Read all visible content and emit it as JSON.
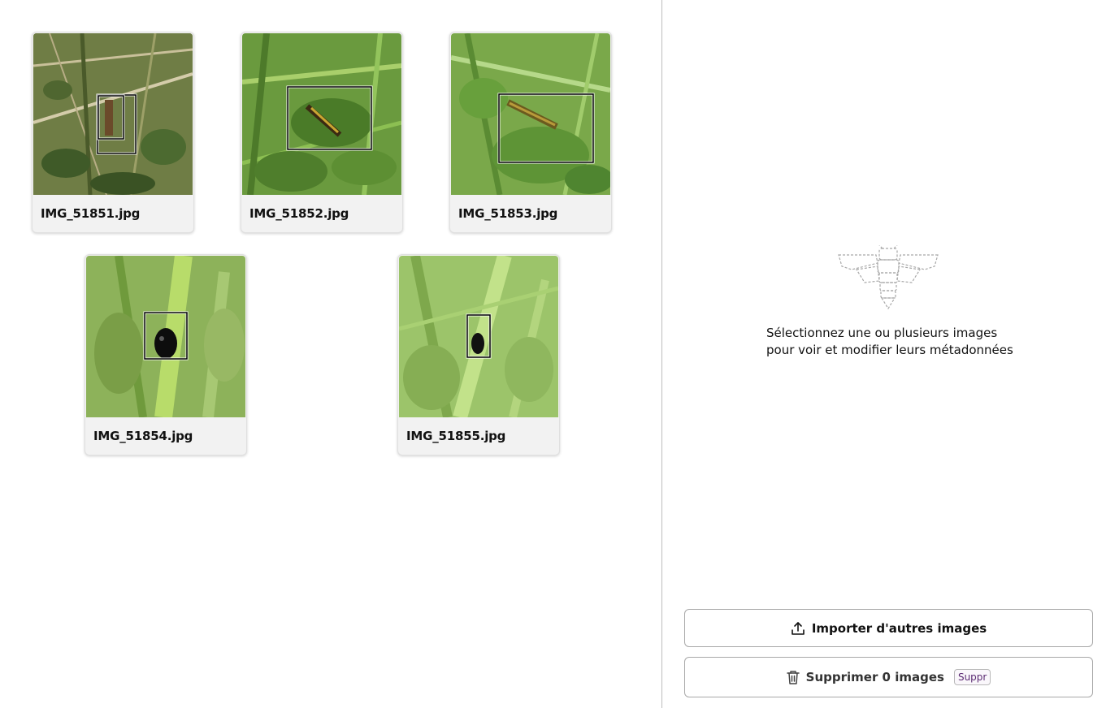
{
  "images": [
    {
      "filename": "IMG_51851.jpg"
    },
    {
      "filename": "IMG_51852.jpg"
    },
    {
      "filename": "IMG_51853.jpg"
    },
    {
      "filename": "IMG_51854.jpg"
    },
    {
      "filename": "IMG_51855.jpg"
    }
  ],
  "sidebar": {
    "empty_state": {
      "line1": "Sélectionnez une ou plusieurs images",
      "line2": "pour voir et modifier leurs métadonnées",
      "icon": "bug-outline-icon"
    },
    "import_button": {
      "label": "Importer d'autres images",
      "icon": "upload-icon"
    },
    "delete_button": {
      "label": "Supprimer 0 images",
      "shortcut": "Suppr",
      "icon": "trash-icon"
    }
  },
  "colors": {
    "shortcut_text": "#5b2a73",
    "divider": "#bdbdbd",
    "card_bg": "#f2f2f2"
  }
}
